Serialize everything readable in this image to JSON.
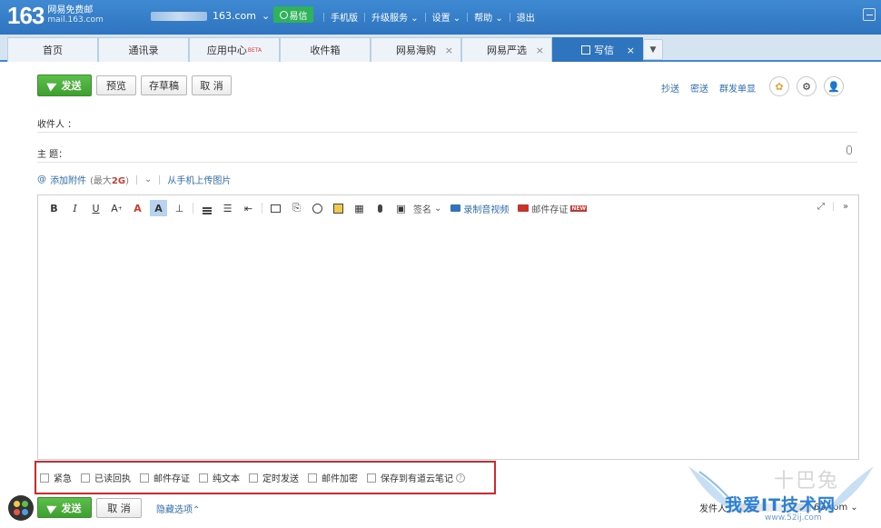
{
  "header": {
    "logo_number": "163",
    "logo_text": "网易免费邮",
    "logo_domain": "mail.163.com",
    "account_suffix": "163.com",
    "yixin_label": "易信",
    "nav": [
      "手机版",
      "升级服务",
      "设置",
      "帮助",
      "退出"
    ]
  },
  "tabs": [
    {
      "label": "首页"
    },
    {
      "label": "通讯录"
    },
    {
      "label": "应用中心",
      "badge": "BETA"
    },
    {
      "label": "收件箱"
    },
    {
      "label": "网易海购"
    },
    {
      "label": "网易严选"
    },
    {
      "label": "写信"
    }
  ],
  "toolbar": {
    "send": "发送",
    "preview": "预览",
    "save_draft": "存草稿",
    "cancel": "取 消",
    "cc": "抄送",
    "bcc": "密送",
    "separate": "群发单显"
  },
  "fields": {
    "to_label": "收件人 ：",
    "subject_label": "主    题："
  },
  "attach": {
    "add": "添加附件",
    "max_prefix": "(最大",
    "max_size": "2G",
    "max_suffix": ")",
    "upload_phone": "从手机上传图片"
  },
  "editor": {
    "sign": "签名",
    "record": "录制音视频",
    "postcard": "邮件存证",
    "new_badge": "NEW"
  },
  "options": [
    {
      "label": "紧急"
    },
    {
      "label": "已读回执"
    },
    {
      "label": "邮件存证"
    },
    {
      "label": "纯文本"
    },
    {
      "label": "定时发送"
    },
    {
      "label": "邮件加密"
    },
    {
      "label": "保存到有道云笔记"
    }
  ],
  "footer": {
    "send": "发送",
    "cancel": "取 消",
    "hide_options": "隐藏选项",
    "sender_label": "发件人：",
    "sender_suffix": "63.com"
  },
  "watermark": {
    "main": "我爱IT技术网",
    "sub": "www.52ij.com",
    "gray": "十巴兔"
  },
  "colors": {
    "brand_blue": "#2f74bf",
    "send_green": "#3ea02f",
    "link_blue": "#2f6fb5",
    "highlight_red": "#d9262b"
  }
}
